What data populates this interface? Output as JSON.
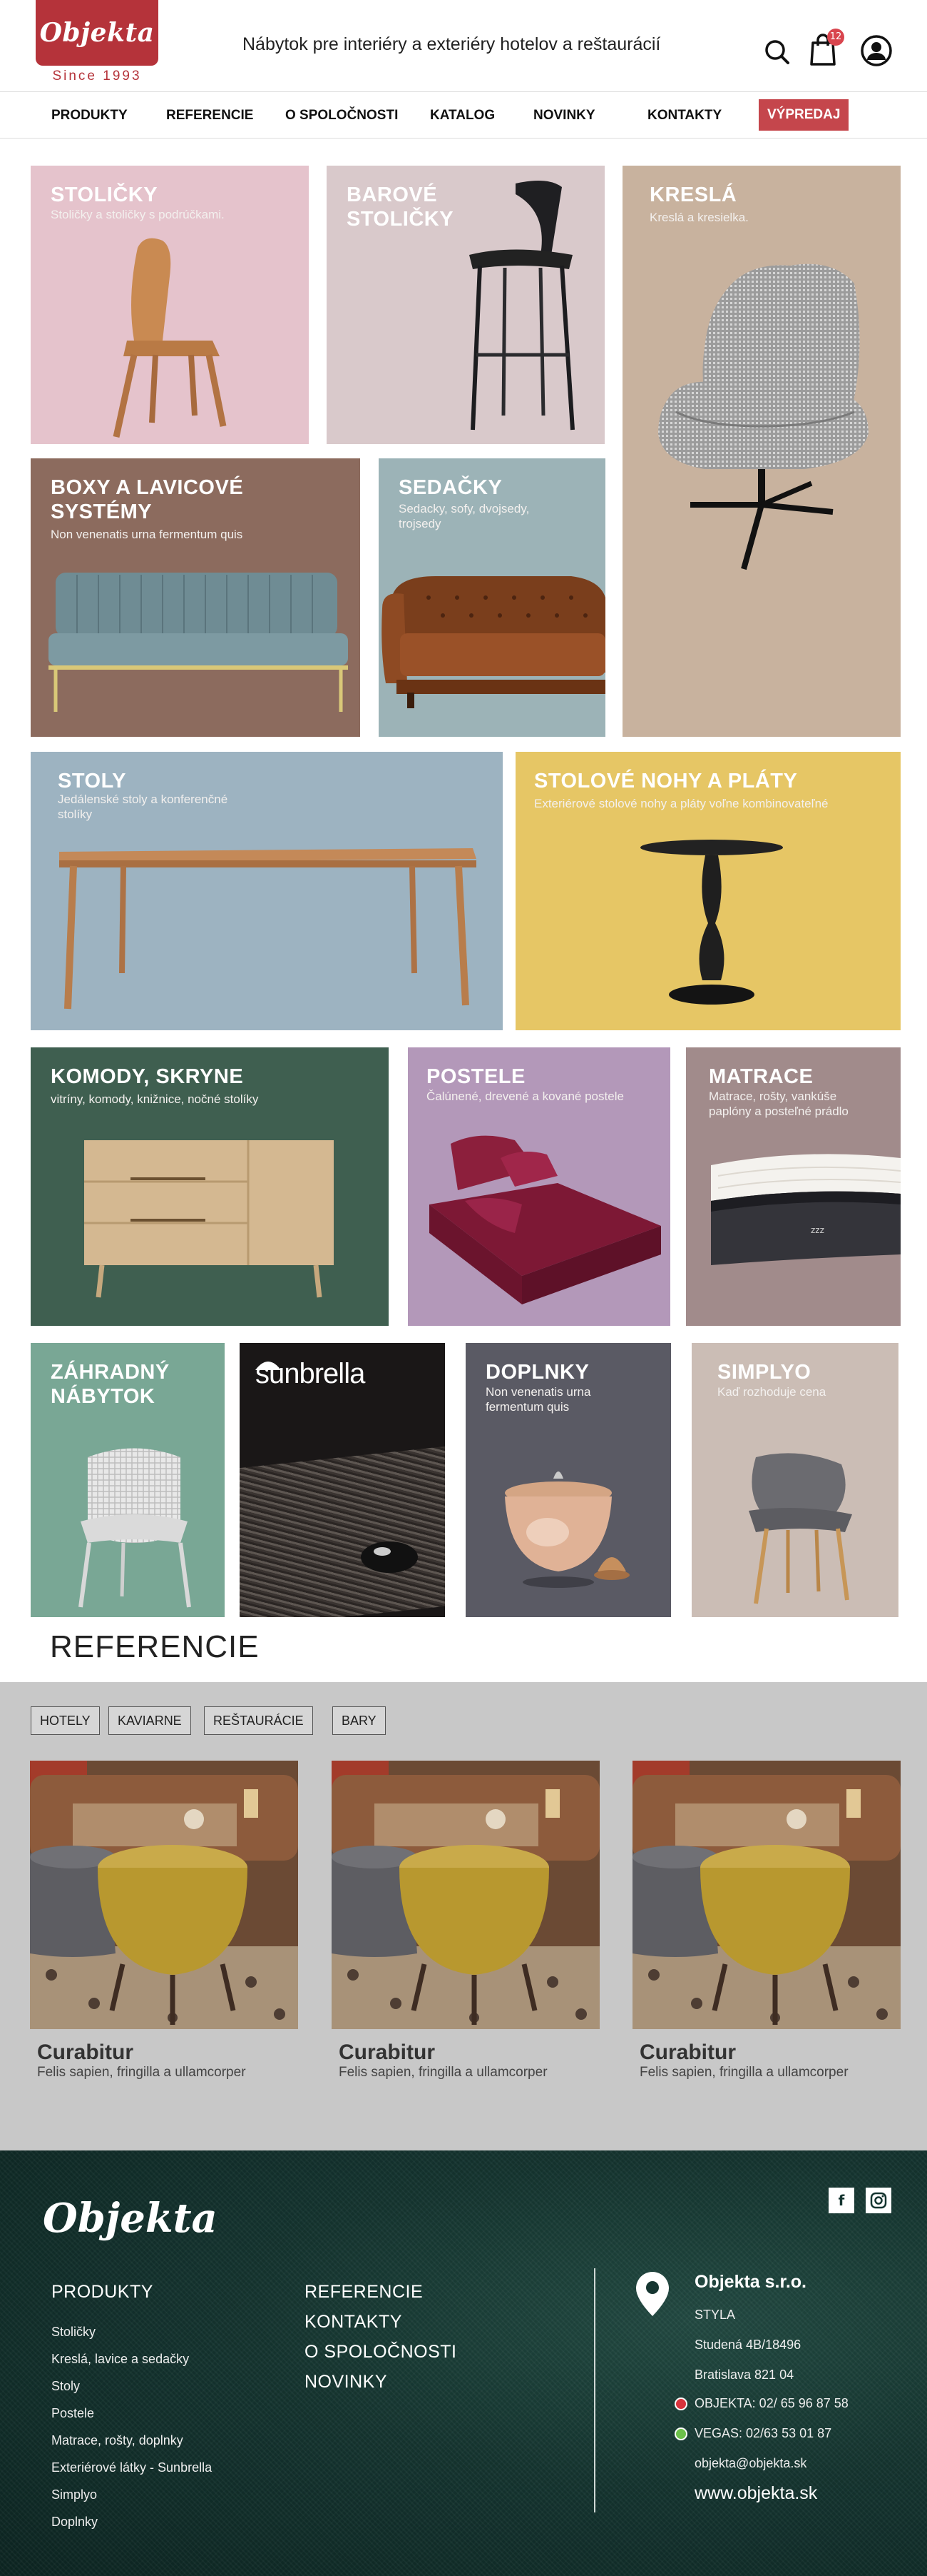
{
  "header": {
    "logo": "Objekta",
    "since": "Since 1993",
    "tagline": "Nábytok pre interiéry a exteriéry hotelov a reštaurácií",
    "cart_count": "12"
  },
  "nav": {
    "items": [
      "PRODUKTY",
      "REFERENCIE",
      "O SPOLOČNOSTI",
      "KATALOG",
      "NOVINKY",
      "KONTAKTY"
    ],
    "sale": "VÝPREDAJ"
  },
  "tiles": {
    "stolicky": {
      "title": "STOLIČKY",
      "sub": "Stoličky a stoličky s podrúčkami.",
      "color": "#e5c3cc"
    },
    "barove": {
      "title": "BAROVÉ\nSTOLIČKY",
      "sub": "",
      "color": "#d9c9cb"
    },
    "kresla": {
      "title": "KRESLÁ",
      "sub": "Kreslá a kresielka.",
      "color": "#c8b29e"
    },
    "boxy": {
      "title": "BOXY A LAVICOVÉ\nSYSTÉMY",
      "sub": "Non venenatis urna fermentum quis",
      "color": "#8c6b5e"
    },
    "sedacky": {
      "title": "SEDAČKY",
      "sub": "Sedacky, sofy, dvojsedy,\ntrojsedy",
      "color": "#9cb3b7"
    },
    "stoly": {
      "title": "STOLY",
      "sub": "Jedálenské stoly a konferenčné\nstolíky",
      "color": "#9db3c1"
    },
    "nohy": {
      "title": "STOLOVÉ NOHY A PLÁTY",
      "sub": "Exteriérové stolové nohy a pláty voľne kombinovateľné",
      "color": "#e6c665"
    },
    "komody": {
      "title": "KOMODY, SKRYNE",
      "sub": "vitríny, komody, knižnice, nočné stolíky",
      "color": "#3f5f50"
    },
    "postele": {
      "title": "POSTELE",
      "sub": "Čalúnené, drevené a kované postele",
      "color": "#b398b9"
    },
    "matrace": {
      "title": "MATRACE",
      "sub": "Matrace, rošty, vankúše\npaplóny a posteľné prádlo",
      "color": "#a18b8b"
    },
    "zahradny": {
      "title": "ZÁHRADNÝ\nNÁBYTOK",
      "sub": "",
      "color": "#79a795"
    },
    "sunbrella": {
      "title": "sunbrella",
      "color": "#1a1717"
    },
    "doplnky": {
      "title": "DOPLNKY",
      "sub": "Non venenatis urna\nfermentum quis",
      "color": "#5a5a64"
    },
    "simplyo": {
      "title": "SIMPLYO",
      "sub": "Kaď rozhoduje cena",
      "color": "#cbbdb5"
    }
  },
  "references": {
    "heading": "REFERENCIE",
    "filters": [
      "HOTELY",
      "KAVIARNE",
      "REŠTAURÁCIE",
      "BARY"
    ],
    "cards": [
      {
        "title": "Curabitur",
        "sub": "Felis sapien, fringilla a ullamcorper"
      },
      {
        "title": "Curabitur",
        "sub": "Felis sapien, fringilla a ullamcorper"
      },
      {
        "title": "Curabitur",
        "sub": "Felis sapien, fringilla a ullamcorper"
      }
    ]
  },
  "footer": {
    "logo": "Objekta",
    "social": [
      "f",
      "instagram-icon"
    ],
    "col1_head": "PRODUKTY",
    "col1_links": [
      "Stoličky",
      "Kreslá, lavice a sedačky",
      "Stoly",
      "Postele",
      "Matrace, rošty, doplnky",
      "Exteriérové látky - Sunbrella",
      "Simplyo",
      "Doplnky"
    ],
    "col2_links": [
      "REFERENCIE",
      "KONTAKTY",
      "O SPOLOČNOSTI",
      "NOVINKY"
    ],
    "company": "Objekta s.r.o.",
    "brand": "STYLA",
    "street": "Studená 4B/18496",
    "city": "Bratislava 821 04",
    "phone1": "OBJEKTA: 02/ 65 96 87 58",
    "phone2": "VEGAS: 02/63 53 01 87",
    "email": "objekta@objekta.sk",
    "web": "www.objekta.sk",
    "dot1_color": "#d8333d",
    "dot2_color": "#6cc04a"
  }
}
